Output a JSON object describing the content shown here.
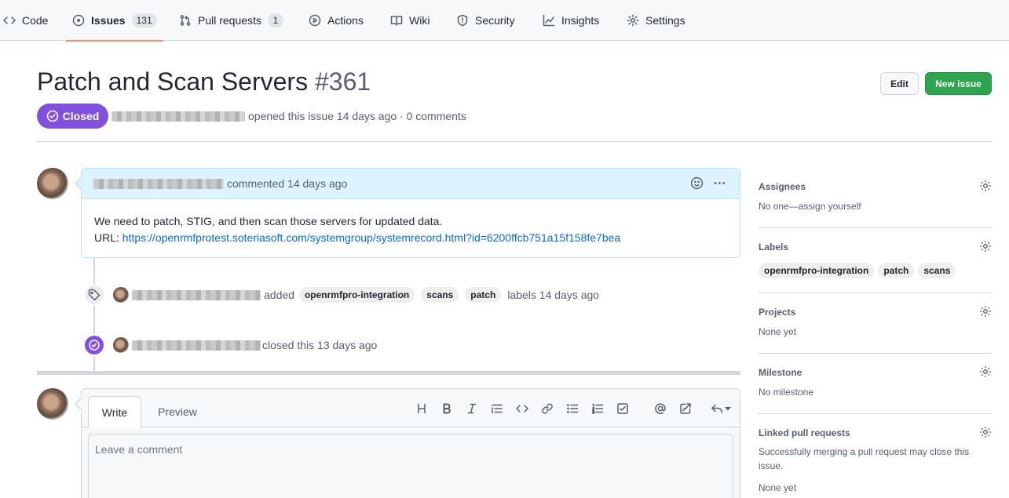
{
  "nav": {
    "tabs": [
      {
        "label": "Code",
        "icon": "code-icon"
      },
      {
        "label": "Issues",
        "icon": "issue-opened-icon",
        "count": "131",
        "active": true
      },
      {
        "label": "Pull requests",
        "icon": "git-pull-request-icon",
        "count": "1"
      },
      {
        "label": "Actions",
        "icon": "play-icon"
      },
      {
        "label": "Wiki",
        "icon": "book-icon"
      },
      {
        "label": "Security",
        "icon": "shield-icon"
      },
      {
        "label": "Insights",
        "icon": "graph-icon"
      },
      {
        "label": "Settings",
        "icon": "gear-icon"
      }
    ]
  },
  "issue": {
    "title": "Patch and Scan Servers",
    "number": "#361",
    "state": "Closed",
    "meta": "opened this issue 14 days ago · 0 comments",
    "edit_label": "Edit",
    "new_issue_label": "New issue"
  },
  "comment": {
    "header": "commented 14 days ago",
    "line1": "We need to patch, STIG, and then scan those servers for updated data.",
    "url_prefix": "URL:",
    "url": "https://openrmfprotest.soteriasoft.com/systemgroup/systemrecord.html?id=6200ffcb751a15f158fe7bea"
  },
  "timeline": {
    "labels_event": {
      "added": "added",
      "labels": [
        "openrmfpro-integration",
        "scans",
        "patch"
      ],
      "suffix": "labels 14 days ago"
    },
    "closed_event": "closed this 13 days ago"
  },
  "editor": {
    "write_tab": "Write",
    "preview_tab": "Preview",
    "placeholder": "Leave a comment",
    "toolbar": [
      "heading",
      "bold",
      "italic",
      "quote",
      "code",
      "link",
      "bulleted-list",
      "numbered-list",
      "task-list",
      "mention",
      "reference",
      "reply"
    ]
  },
  "sidebar": {
    "assignees": {
      "title": "Assignees",
      "text": "No one—assign yourself"
    },
    "labels": {
      "title": "Labels",
      "items": [
        "openrmfpro-integration",
        "patch",
        "scans"
      ]
    },
    "projects": {
      "title": "Projects",
      "text": "None yet"
    },
    "milestone": {
      "title": "Milestone",
      "text": "No milestone"
    },
    "linked_prs": {
      "title": "Linked pull requests",
      "text": "Successfully merging a pull request may close this issue.",
      "text2": "None yet"
    }
  },
  "colors": {
    "closed_purple": "#8250df",
    "new_issue_green": "#2da44e",
    "link_blue": "#0969da",
    "active_tab_underline": "#fd8c73"
  }
}
